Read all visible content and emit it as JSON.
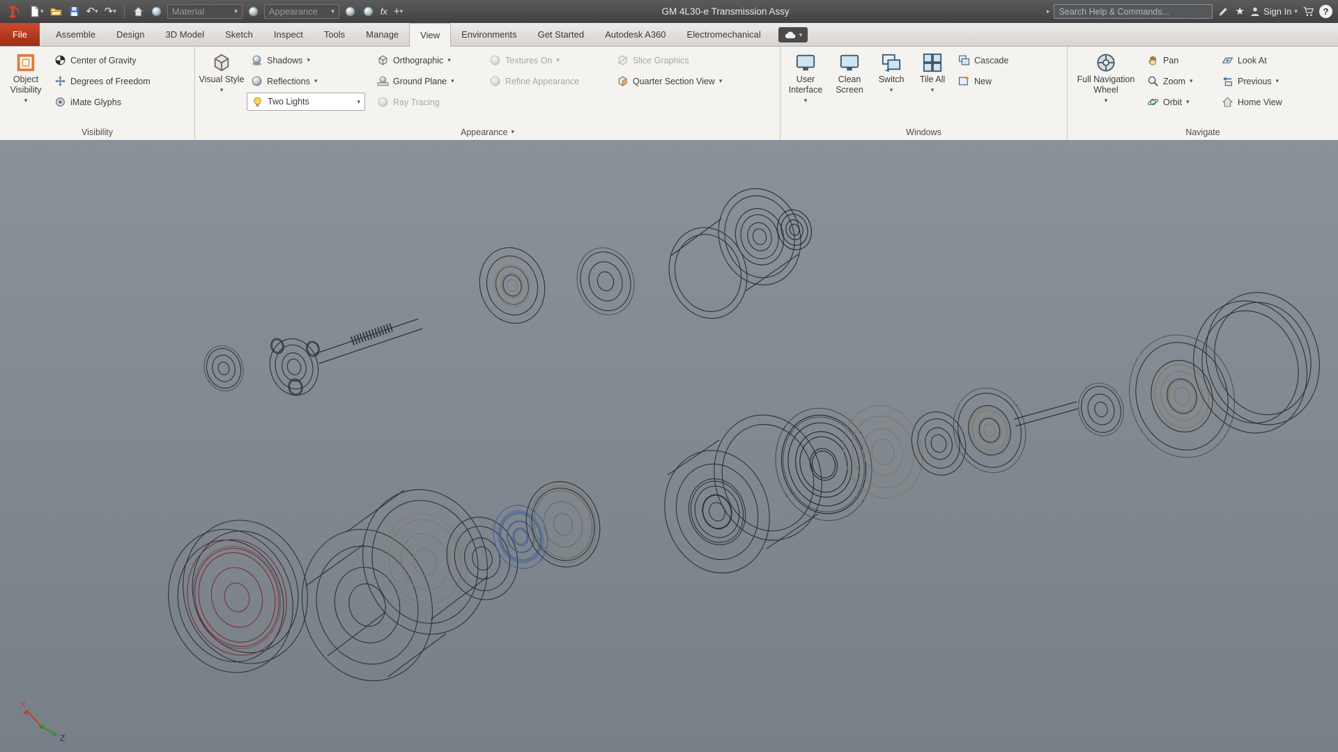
{
  "icons": {
    "caret": "▾",
    "caret_right": "▸",
    "undo": "↶",
    "redo": "↷",
    "star": "★",
    "plus": "+",
    "fx": "fx",
    "help": "?"
  },
  "titlebar": {
    "material_label": "Material",
    "appearance_label": "Appearance",
    "document_title": "GM 4L30-e Transmission Assy",
    "search_placeholder": "Search Help & Commands...",
    "sign_in": "Sign In"
  },
  "tabs": [
    {
      "label": "File"
    },
    {
      "label": "Assemble"
    },
    {
      "label": "Design"
    },
    {
      "label": "3D Model"
    },
    {
      "label": "Sketch"
    },
    {
      "label": "Inspect"
    },
    {
      "label": "Tools"
    },
    {
      "label": "Manage"
    },
    {
      "label": "View"
    },
    {
      "label": "Environments"
    },
    {
      "label": "Get Started"
    },
    {
      "label": "Autodesk A360"
    },
    {
      "label": "Electromechanical"
    }
  ],
  "ribbon": {
    "visibility": {
      "group_label": "Visibility",
      "object_visibility": "Object Visibility",
      "center_of_gravity": "Center of Gravity",
      "degrees_of_freedom": "Degrees of Freedom",
      "imate_glyphs": "iMate Glyphs"
    },
    "appearance": {
      "group_label": "Appearance",
      "visual_style": "Visual Style",
      "shadows": "Shadows",
      "reflections": "Reflections",
      "two_lights": "Two Lights",
      "orthographic": "Orthographic",
      "ground_plane": "Ground Plane",
      "ray_tracing": "Ray Tracing",
      "textures_on": "Textures On",
      "refine_appearance": "Refine Appearance",
      "slice_graphics": "Slice Graphics",
      "quarter_section_view": "Quarter Section View"
    },
    "windows": {
      "group_label": "Windows",
      "user_interface": "User Interface",
      "clean_screen": "Clean Screen",
      "switch": "Switch",
      "tile_all": "Tile All",
      "cascade": "Cascade",
      "new": "New"
    },
    "navigate": {
      "group_label": "Navigate",
      "full_navigation_wheel": "Full Navigation Wheel",
      "pan": "Pan",
      "zoom": "Zoom",
      "orbit": "Orbit",
      "look_at": "Look At",
      "previous": "Previous",
      "home_view": "Home View"
    }
  },
  "viewport": {
    "axis_x": "X",
    "axis_z": "Z"
  }
}
